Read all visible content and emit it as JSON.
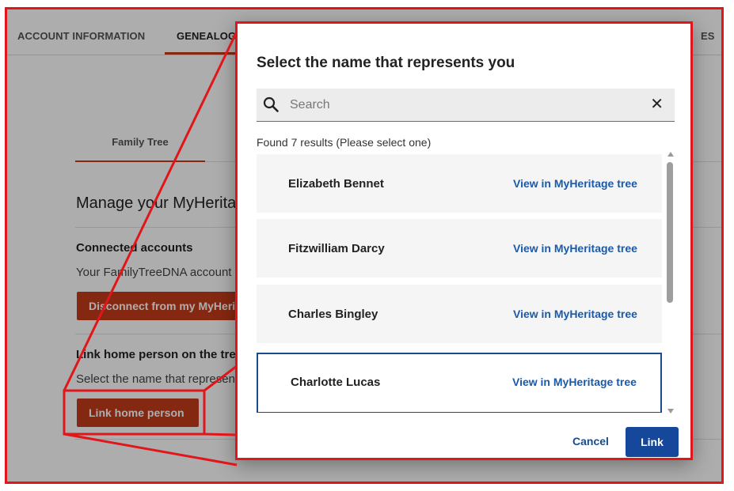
{
  "top_nav": {
    "tabs": [
      {
        "label": "ACCOUNT INFORMATION"
      },
      {
        "label": "GENEALOGY"
      },
      {
        "label": "ES"
      }
    ],
    "active_index": 1
  },
  "sub_tabs": {
    "family_tree": "Family Tree"
  },
  "manage": {
    "title": "Manage your MyHeritage",
    "connected_heading": "Connected accounts",
    "connected_text": "Your FamilyTreeDNA account",
    "disconnect_button": "Disconnect from my MyHeritage",
    "link_heading": "Link home person on the tree",
    "link_text": "Select the name that represents you",
    "link_button": "Link home person"
  },
  "modal": {
    "title": "Select the name that represents you",
    "search": {
      "placeholder": "Search",
      "value": ""
    },
    "clear_icon": "close-icon",
    "search_icon": "magnifier-icon",
    "found_text": "Found 7 results (Please select one)",
    "results": [
      {
        "name": "Elizabeth Bennet",
        "link": "View in MyHeritage tree"
      },
      {
        "name": "Fitzwilliam Darcy",
        "link": "View in MyHeritage tree"
      },
      {
        "name": "Charles Bingley",
        "link": "View in MyHeritage tree"
      },
      {
        "name": "Charlotte Lucas",
        "link": "View in MyHeritage tree"
      }
    ],
    "selected_index": 3,
    "cancel_label": "Cancel",
    "link_label": "Link"
  },
  "colors": {
    "accent_red": "#c43c1a",
    "callout_red": "#e0161a",
    "primary_blue": "#15479a",
    "link_blue": "#1a5aa8"
  }
}
